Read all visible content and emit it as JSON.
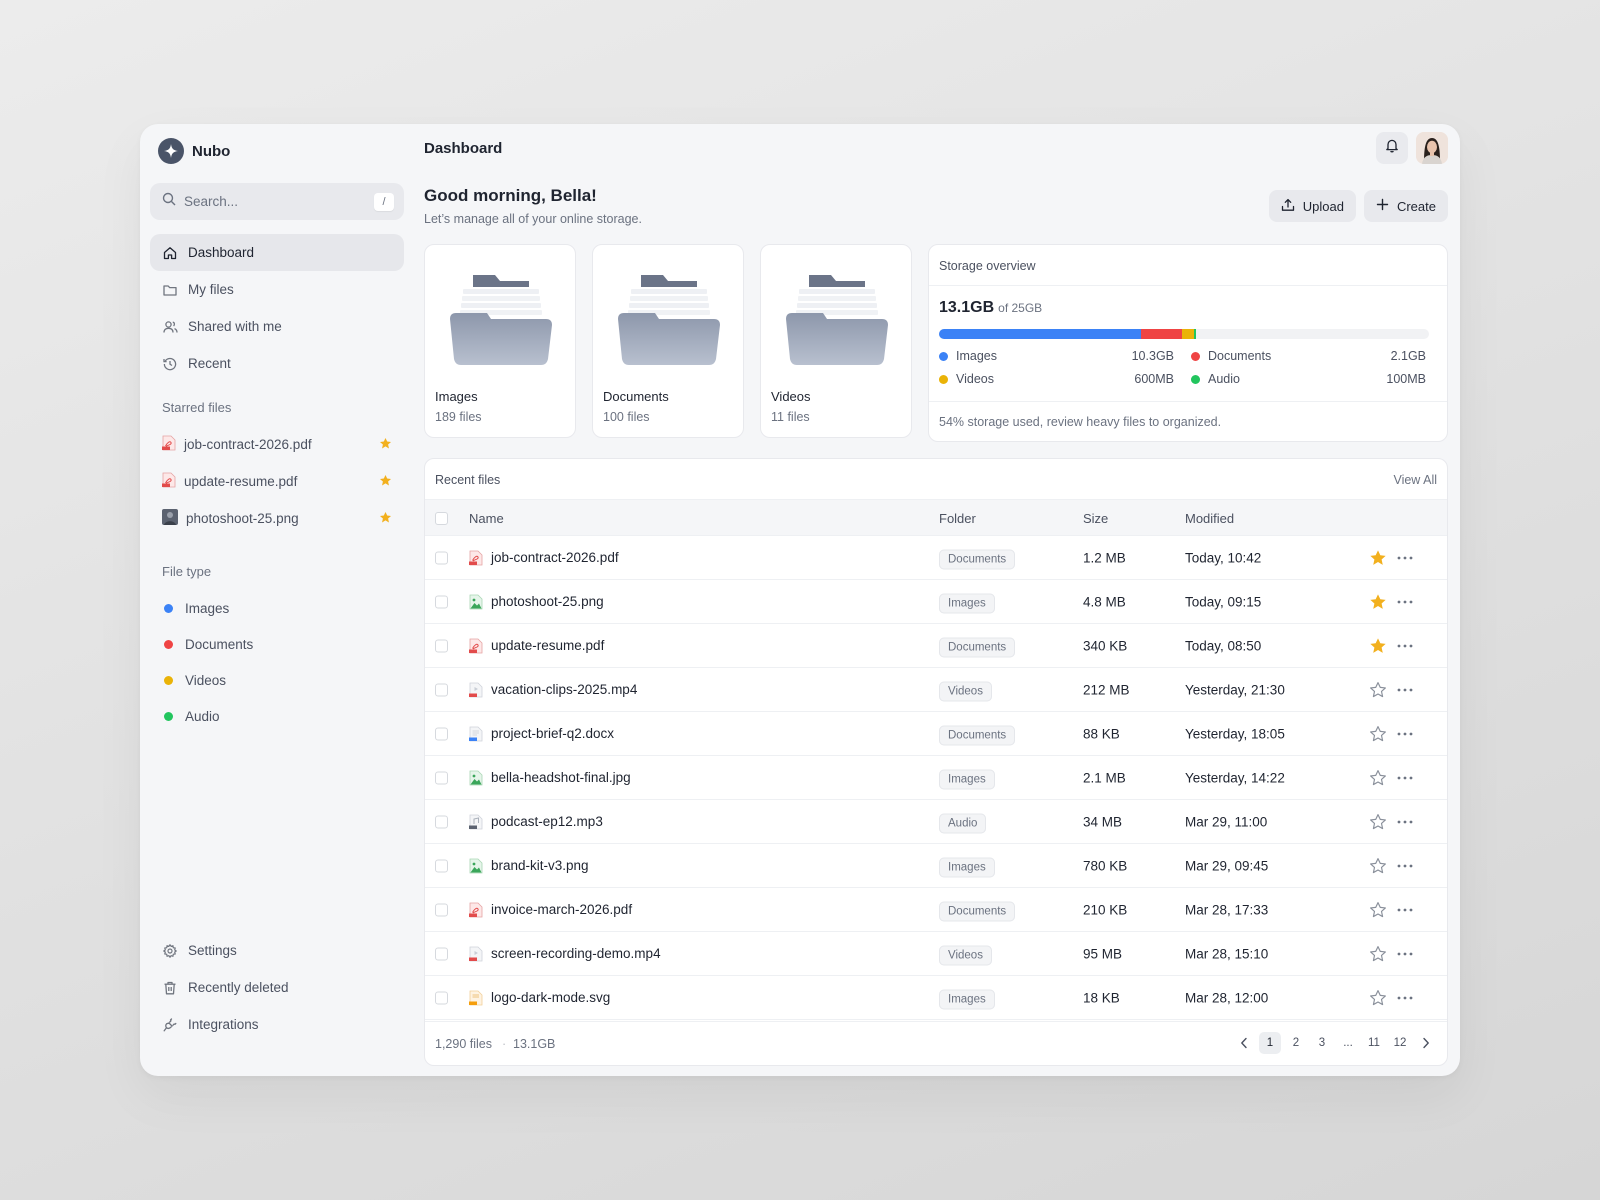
{
  "app": {
    "name": "Nubo"
  },
  "search": {
    "placeholder": "Search...",
    "shortcut": "/"
  },
  "nav": [
    {
      "label": "Dashboard",
      "icon": "home-icon",
      "active": true
    },
    {
      "label": "My files",
      "icon": "folder-icon"
    },
    {
      "label": "Shared with me",
      "icon": "users-icon"
    },
    {
      "label": "Recent",
      "icon": "clock-icon"
    }
  ],
  "starred": {
    "title": "Starred files",
    "items": [
      {
        "name": "job-contract-2026.pdf",
        "icon": "pdf-icon"
      },
      {
        "name": "update-resume.pdf",
        "icon": "pdf-icon"
      },
      {
        "name": "photoshoot-25.png",
        "icon": "photo-thumbnail-icon"
      }
    ]
  },
  "filetype": {
    "title": "File type",
    "items": [
      {
        "label": "Images",
        "color": "#3b82f6"
      },
      {
        "label": "Documents",
        "color": "#ef4444"
      },
      {
        "label": "Videos",
        "color": "#eab308"
      },
      {
        "label": "Audio",
        "color": "#22c55e"
      }
    ]
  },
  "bottom_nav": [
    {
      "label": "Settings",
      "icon": "gear-icon"
    },
    {
      "label": "Recently deleted",
      "icon": "trash-icon"
    },
    {
      "label": "Integrations",
      "icon": "plug-icon"
    }
  ],
  "header": {
    "title": "Dashboard"
  },
  "greeting": {
    "title": "Good morning, Bella!",
    "subtitle": "Let’s manage all of your online storage."
  },
  "actions": {
    "upload": "Upload",
    "create": "Create"
  },
  "folders": [
    {
      "name": "Images",
      "count": "189 files"
    },
    {
      "name": "Documents",
      "count": "100 files"
    },
    {
      "name": "Videos",
      "count": "11 files"
    }
  ],
  "storage": {
    "title": "Storage overview",
    "used": "13.1GB",
    "of": "of 25GB",
    "segments": [
      {
        "label": "Images",
        "value": "10.3GB",
        "fraction": 0.412,
        "color": "#3b82f6"
      },
      {
        "label": "Documents",
        "value": "2.1GB",
        "fraction": 0.084,
        "color": "#ef4444"
      },
      {
        "label": "Videos",
        "value": "600MB",
        "fraction": 0.024,
        "color": "#eab308"
      },
      {
        "label": "Audio",
        "value": "100MB",
        "fraction": 0.004,
        "color": "#22c55e"
      }
    ],
    "note": "54% storage used, review heavy files to organized."
  },
  "recent": {
    "title": "Recent files",
    "view_all": "View All",
    "columns": {
      "name": "Name",
      "folder": "Folder",
      "size": "Size",
      "modified": "Modified"
    },
    "rows": [
      {
        "name": "job-contract-2026.pdf",
        "type": "pdf",
        "folder": "Documents",
        "size": "1.2 MB",
        "modified": "Today, 10:42",
        "starred": true
      },
      {
        "name": "photoshoot-25.png",
        "type": "image",
        "folder": "Images",
        "size": "4.8 MB",
        "modified": "Today, 09:15",
        "starred": true
      },
      {
        "name": "update-resume.pdf",
        "type": "pdf",
        "folder": "Documents",
        "size": "340 KB",
        "modified": "Today, 08:50",
        "starred": true
      },
      {
        "name": "vacation-clips-2025.mp4",
        "type": "video",
        "folder": "Videos",
        "size": "212 MB",
        "modified": "Yesterday, 21:30",
        "starred": false
      },
      {
        "name": "project-brief-q2.docx",
        "type": "doc",
        "folder": "Documents",
        "size": "88 KB",
        "modified": "Yesterday, 18:05",
        "starred": false
      },
      {
        "name": "bella-headshot-final.jpg",
        "type": "image",
        "folder": "Images",
        "size": "2.1 MB",
        "modified": "Yesterday, 14:22",
        "starred": false
      },
      {
        "name": "podcast-ep12.mp3",
        "type": "audio",
        "folder": "Audio",
        "size": "34 MB",
        "modified": "Mar 29, 11:00",
        "starred": false
      },
      {
        "name": "brand-kit-v3.png",
        "type": "image",
        "folder": "Images",
        "size": "780 KB",
        "modified": "Mar 29, 09:45",
        "starred": false
      },
      {
        "name": "invoice-march-2026.pdf",
        "type": "pdf",
        "folder": "Documents",
        "size": "210 KB",
        "modified": "Mar 28, 17:33",
        "starred": false
      },
      {
        "name": "screen-recording-demo.mp4",
        "type": "video",
        "folder": "Videos",
        "size": "95 MB",
        "modified": "Mar 28, 15:10",
        "starred": false
      },
      {
        "name": "logo-dark-mode.svg",
        "type": "svg",
        "folder": "Images",
        "size": "18 KB",
        "modified": "Mar 28, 12:00",
        "starred": false
      }
    ],
    "footer": {
      "count": "1,290 files",
      "total": "13.1GB"
    },
    "pages": [
      "1",
      "2",
      "3",
      "...",
      "11",
      "12"
    ],
    "current_page": "1"
  },
  "colors": {
    "star": "#f2b01e",
    "accent": "#4a5468"
  }
}
